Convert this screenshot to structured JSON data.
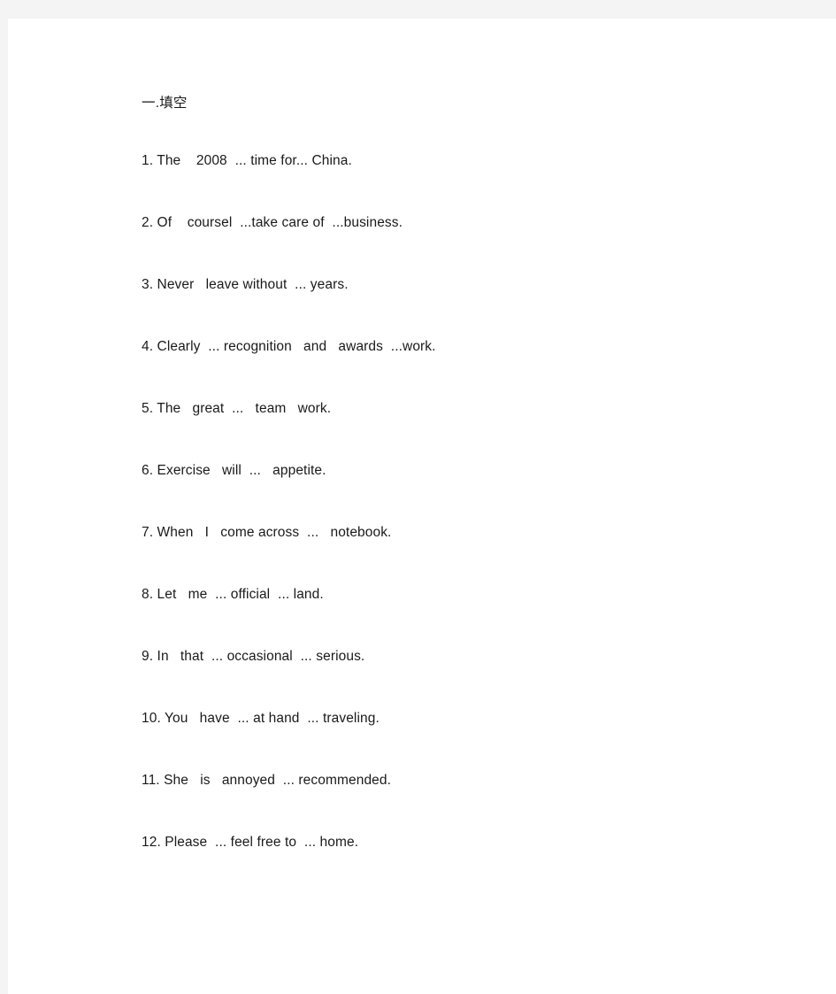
{
  "document": {
    "background_color": "#f4f4f4",
    "page_color": "#ffffff",
    "text_color": "#1a1a1a",
    "heading": "一.填空",
    "questions": [
      {
        "number": "1.",
        "text": "1. The    2008  ... time for... China."
      },
      {
        "number": "2.",
        "text": "2. Of    coursel  ...take care of  ...business."
      },
      {
        "number": "3.",
        "text": "3. Never   leave without  ... years."
      },
      {
        "number": "4.",
        "text": "4. Clearly  ... recognition   and   awards  ...work."
      },
      {
        "number": "5.",
        "text": "5. The   great  ...   team   work."
      },
      {
        "number": "6.",
        "text": "6. Exercise   will  ...   appetite."
      },
      {
        "number": "7.",
        "text": "7. When   I   come across  ...   notebook."
      },
      {
        "number": "8.",
        "text": "8. Let   me  ... official  ... land."
      },
      {
        "number": "9.",
        "text": "9. In   that  ... occasional  ... serious."
      },
      {
        "number": "10.",
        "text": "10. You   have  ... at hand  ... traveling."
      },
      {
        "number": "11.",
        "text": "11. She   is   annoyed  ... recommended."
      },
      {
        "number": "12.",
        "text": "12. Please  ... feel free to  ... home."
      }
    ]
  }
}
